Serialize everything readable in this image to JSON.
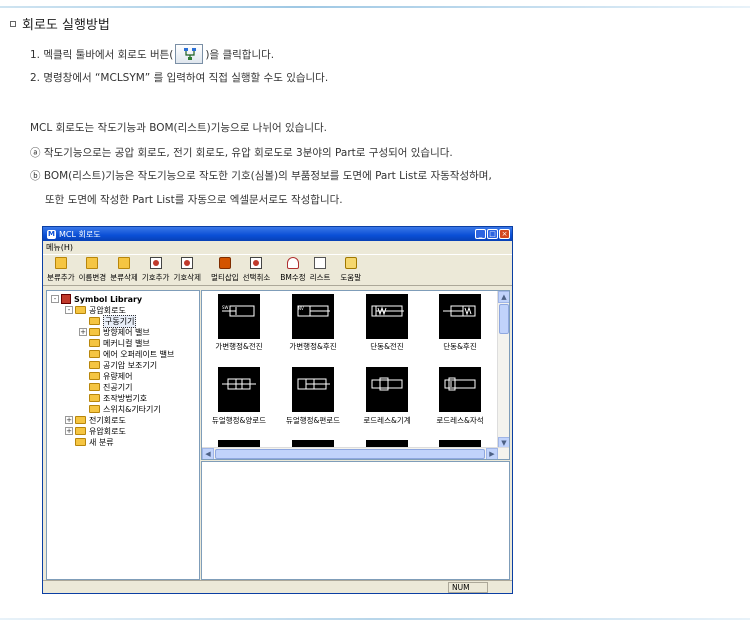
{
  "heading": "회로도 실행방법",
  "steps": {
    "step1_before": "1. 멕클릭 툴바에서 회로도 버튼(",
    "step1_after": ")을 클릭합니다.",
    "step2": "2. 명령창에서 “MCLSYM” 를 입력하여 직접 실행할 수도 있습니다."
  },
  "description": {
    "intro": "MCL 회로도는 작도기능과 BOM(리스트)기능으로 나뉘어 있습니다.",
    "a": "ⓐ 작도기능으로는 공압 회로도, 전기 회로도, 유압 회로도로 3분야의 Part로 구성되어 있습니다.",
    "b": "ⓑ BOM(리스트)기능은 작도기능으로 작도한 기호(심볼)의 부품정보를 도면에 Part List로 자동작성하며,",
    "b2": "또한 도면에 작성한 Part List를 자동으로 엑셀문서로도 작성합니다."
  },
  "window": {
    "title": "MCL 회로도",
    "app_icon": "M",
    "menu": "메뉴(H)",
    "toolbar": [
      {
        "label": "분류추가",
        "icon": "folder-add-icon"
      },
      {
        "label": "이름변경",
        "icon": "folder-rename-icon"
      },
      {
        "label": "분류삭제",
        "icon": "folder-delete-icon"
      },
      {
        "label": "기호추가",
        "icon": "symbol-add-icon"
      },
      {
        "label": "기호삭제",
        "icon": "symbol-delete-icon"
      },
      {
        "label": "멀티삽입",
        "icon": "multi-insert-icon"
      },
      {
        "label": "선택취소",
        "icon": "deselect-icon"
      },
      {
        "label": "BM수정",
        "icon": "bm-edit-icon"
      },
      {
        "label": "리스트",
        "icon": "list-icon"
      },
      {
        "label": "도움말",
        "icon": "help-icon"
      }
    ],
    "tree": [
      {
        "label": "Symbol Library",
        "exp": "-"
      },
      {
        "label": "공압회로도",
        "exp": "-"
      },
      {
        "label": "구동기기",
        "exp": ""
      },
      {
        "label": "방향제어 밸브",
        "exp": "+"
      },
      {
        "label": "메커니컬 밸브",
        "exp": ""
      },
      {
        "label": "에어 오퍼레이트 밸브",
        "exp": ""
      },
      {
        "label": "공기압 보조기기",
        "exp": ""
      },
      {
        "label": "유량제어",
        "exp": ""
      },
      {
        "label": "진공기기",
        "exp": ""
      },
      {
        "label": "조작방법기호",
        "exp": ""
      },
      {
        "label": "스위치&기타기기",
        "exp": ""
      },
      {
        "label": "전기회로도",
        "exp": "+"
      },
      {
        "label": "유압회로도",
        "exp": "+"
      },
      {
        "label": "새 분류",
        "exp": ""
      }
    ],
    "symbols": [
      "가변행정&전진",
      "가변행정&후진",
      "단동&전진",
      "단동&후진",
      "듀얼행정&양로드",
      "듀얼행정&편로드",
      "로드레스&기계",
      "로드레스&자석"
    ],
    "status": "NUM"
  },
  "colors": {
    "titlebar": "#0a4fd6",
    "window_bg": "#ece9d8",
    "folder": "#f5c542"
  }
}
